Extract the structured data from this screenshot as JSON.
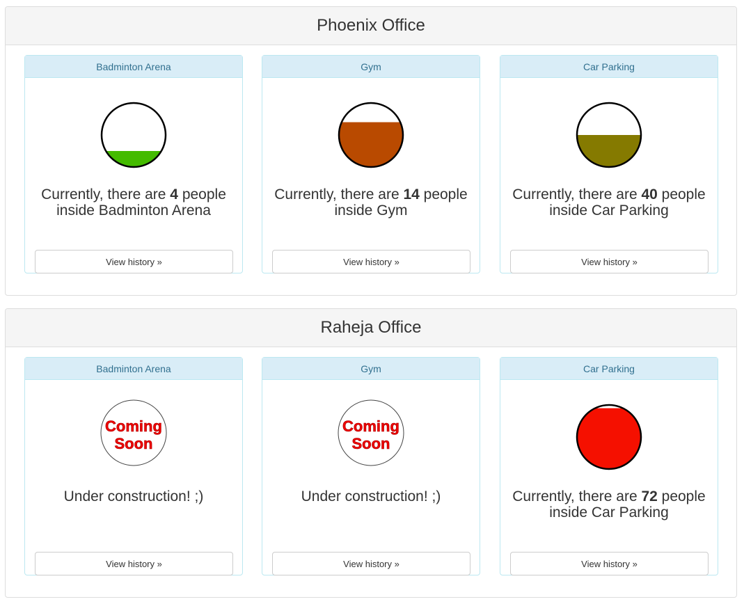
{
  "offices": [
    {
      "name": "Phoenix Office",
      "facilities": [
        {
          "name": "Badminton Arena",
          "status": "active",
          "count": "4",
          "caption_prefix": "Currently, there are ",
          "caption_mid": " people",
          "caption_suffix": "inside Badminton Arena",
          "fill_level": 0.25,
          "fill_color": "#44bb00",
          "button": "View history »"
        },
        {
          "name": "Gym",
          "status": "active",
          "count": "14",
          "caption_prefix": "Currently, there are ",
          "caption_mid": " people",
          "caption_suffix": "inside Gym",
          "fill_level": 0.7,
          "fill_color": "#b94a00",
          "button": "View history »"
        },
        {
          "name": "Car Parking",
          "status": "active",
          "count": "40",
          "caption_prefix": "Currently, there are ",
          "caption_mid": " people",
          "caption_suffix": "inside Car Parking",
          "fill_level": 0.5,
          "fill_color": "#857a00",
          "button": "View history »"
        }
      ]
    },
    {
      "name": "Raheja Office",
      "facilities": [
        {
          "name": "Badminton Arena",
          "status": "coming_soon",
          "badge_line1": "Coming",
          "badge_line2": "Soon",
          "caption": "Under construction! ;)",
          "button": "View history »"
        },
        {
          "name": "Gym",
          "status": "coming_soon",
          "badge_line1": "Coming",
          "badge_line2": "Soon",
          "caption": "Under construction! ;)",
          "button": "View history »"
        },
        {
          "name": "Car Parking",
          "status": "active",
          "count": "72",
          "caption_prefix": "Currently, there are ",
          "caption_mid": " people",
          "caption_suffix": "inside Car Parking",
          "fill_level": 0.95,
          "fill_color": "#f51000",
          "button": "View history »"
        }
      ]
    }
  ]
}
